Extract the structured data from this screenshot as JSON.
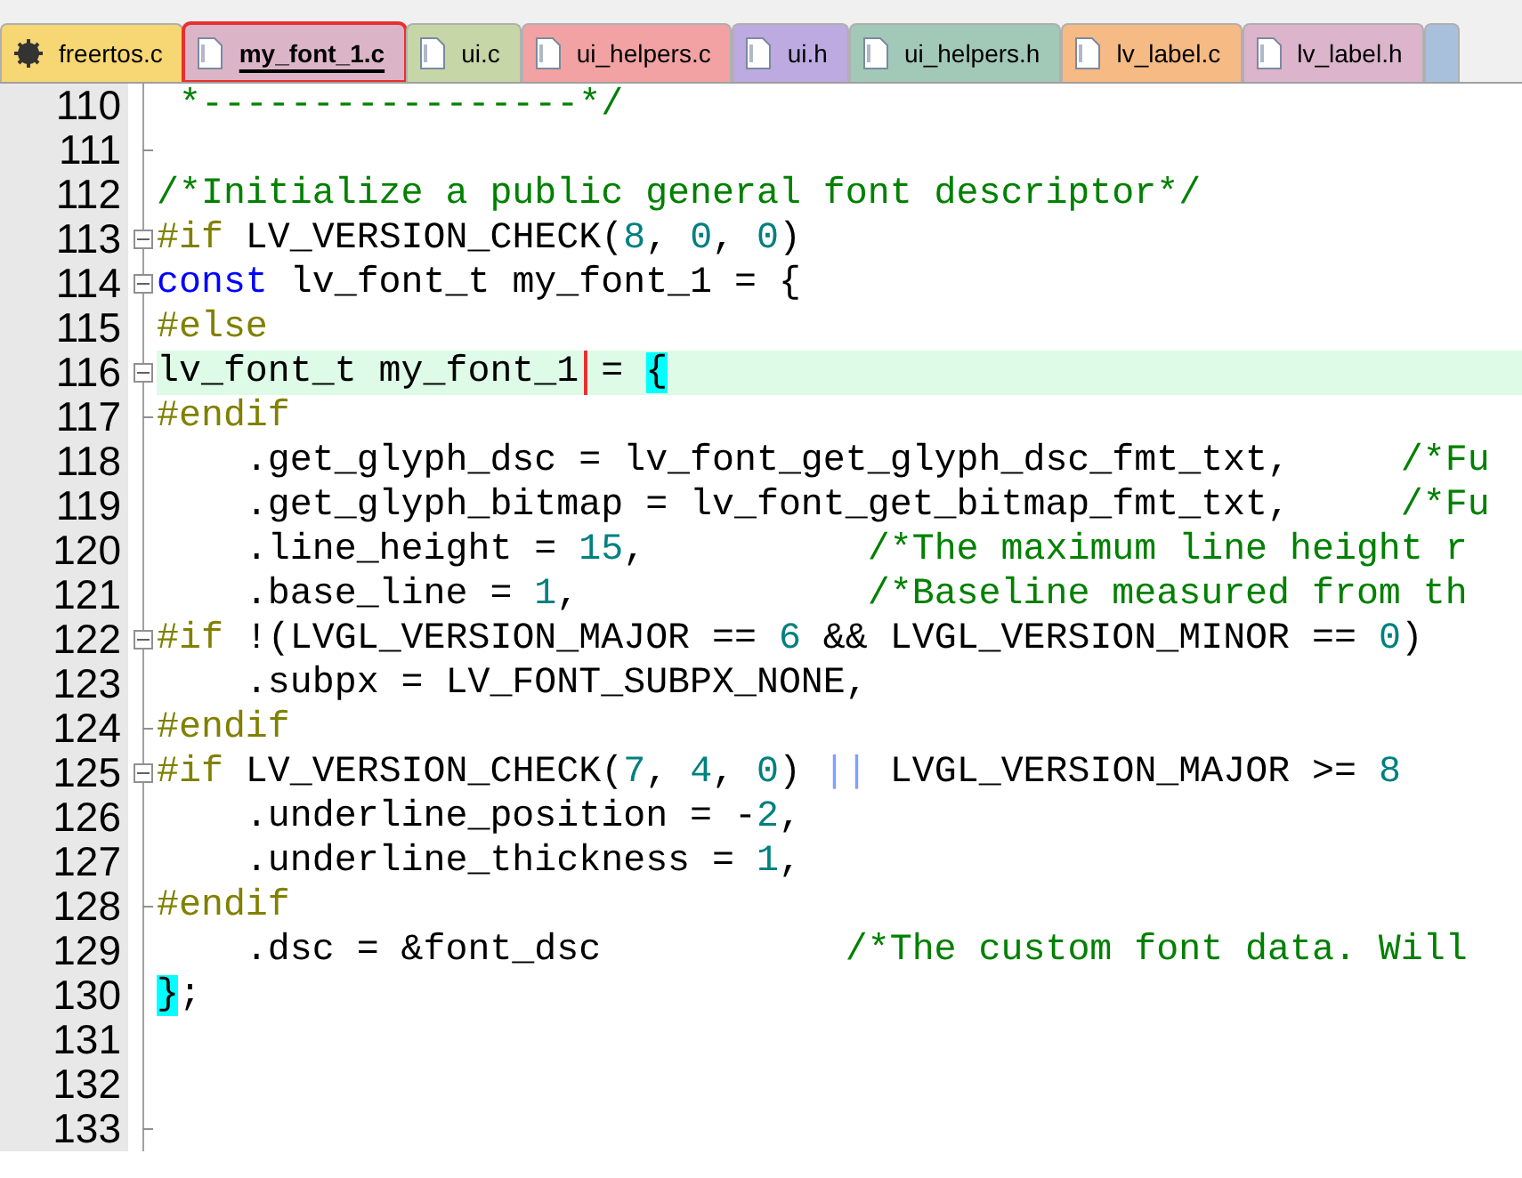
{
  "tabs": [
    {
      "label": "freertos.c",
      "kind": "gear",
      "color": "#f7d774",
      "selected": false,
      "highlighted": false
    },
    {
      "label": "my_font_1.c",
      "kind": "file",
      "color": "#dcb4c8",
      "selected": true,
      "highlighted": true
    },
    {
      "label": "ui.c",
      "kind": "file",
      "color": "#c6d6a6",
      "selected": false,
      "highlighted": false
    },
    {
      "label": "ui_helpers.c",
      "kind": "file",
      "color": "#f2a2a2",
      "selected": false,
      "highlighted": false
    },
    {
      "label": "ui.h",
      "kind": "file",
      "color": "#bcaae0",
      "selected": false,
      "highlighted": false
    },
    {
      "label": "ui_helpers.h",
      "kind": "file",
      "color": "#a2c8b8",
      "selected": false,
      "highlighted": false
    },
    {
      "label": "lv_label.c",
      "kind": "file",
      "color": "#f6ba84",
      "selected": false,
      "highlighted": false
    },
    {
      "label": "lv_label.h",
      "kind": "file",
      "color": "#dcb4cc",
      "selected": false,
      "highlighted": false
    }
  ],
  "editor": {
    "lines": [
      {
        "number": "110",
        "fold_start": false,
        "fold_end": false,
        "current": false,
        "segments": [
          {
            "kind": "comment",
            "text": " *-----------------*/"
          }
        ]
      },
      {
        "number": "111",
        "fold_start": false,
        "fold_end": true,
        "current": false
      },
      {
        "number": "112",
        "fold_start": false,
        "fold_end": false,
        "current": false,
        "segments": [
          {
            "kind": "comment",
            "text": "/*Initialize a public general font descriptor*/"
          }
        ]
      },
      {
        "number": "113",
        "fold_start": true,
        "fold_end": false,
        "current": false,
        "segments": [
          {
            "kind": "preproc",
            "text": "#if"
          },
          {
            "kind": "plain",
            "text": " LV_VERSION_CHECK("
          },
          {
            "kind": "number",
            "text": "8"
          },
          {
            "kind": "plain",
            "text": ", "
          },
          {
            "kind": "number",
            "text": "0"
          },
          {
            "kind": "plain",
            "text": ", "
          },
          {
            "kind": "number",
            "text": "0"
          },
          {
            "kind": "plain",
            "text": ")"
          }
        ]
      },
      {
        "number": "114",
        "fold_start": true,
        "fold_end": false,
        "current": false,
        "segments": [
          {
            "kind": "keyword",
            "text": "const"
          },
          {
            "kind": "plain",
            "text": " lv_font_t my_font_1 = {"
          }
        ]
      },
      {
        "number": "115",
        "fold_start": false,
        "fold_end": false,
        "current": false,
        "segments": [
          {
            "kind": "preproc",
            "text": "#else"
          }
        ]
      },
      {
        "number": "116",
        "fold_start": true,
        "fold_end": false,
        "current": true,
        "segments": [
          {
            "kind": "plain",
            "text": "lv_font_t my_font_1",
            "boxed": true
          },
          {
            "kind": "plain",
            "text": " = "
          },
          {
            "kind": "brace",
            "text": "{"
          }
        ]
      },
      {
        "number": "117",
        "fold_start": false,
        "fold_end": true,
        "current": false,
        "segments": [
          {
            "kind": "preproc",
            "text": "#endif"
          }
        ]
      },
      {
        "number": "118",
        "fold_start": false,
        "fold_end": false,
        "current": false,
        "segments": [
          {
            "kind": "plain",
            "text": "    .get_glyph_dsc = lv_font_get_glyph_dsc_fmt_txt,     "
          },
          {
            "kind": "comment",
            "text": "/*Fu"
          }
        ]
      },
      {
        "number": "119",
        "fold_start": false,
        "fold_end": false,
        "current": false,
        "segments": [
          {
            "kind": "plain",
            "text": "    .get_glyph_bitmap = lv_font_get_bitmap_fmt_txt,     "
          },
          {
            "kind": "comment",
            "text": "/*Fu"
          }
        ]
      },
      {
        "number": "120",
        "fold_start": false,
        "fold_end": false,
        "current": false,
        "segments": [
          {
            "kind": "plain",
            "text": "    .line_height = "
          },
          {
            "kind": "number",
            "text": "15"
          },
          {
            "kind": "plain",
            "text": ",          "
          },
          {
            "kind": "comment",
            "text": "/*The maximum line height r"
          }
        ]
      },
      {
        "number": "121",
        "fold_start": false,
        "fold_end": false,
        "current": false,
        "segments": [
          {
            "kind": "plain",
            "text": "    .base_line = "
          },
          {
            "kind": "number",
            "text": "1"
          },
          {
            "kind": "plain",
            "text": ",             "
          },
          {
            "kind": "comment",
            "text": "/*Baseline measured from th"
          }
        ]
      },
      {
        "number": "122",
        "fold_start": true,
        "fold_end": false,
        "current": false,
        "segments": [
          {
            "kind": "preproc",
            "text": "#if"
          },
          {
            "kind": "plain",
            "text": " !(LVGL_VERSION_MAJOR == "
          },
          {
            "kind": "number",
            "text": "6"
          },
          {
            "kind": "plain",
            "text": " && LVGL_VERSION_MINOR == "
          },
          {
            "kind": "number",
            "text": "0"
          },
          {
            "kind": "plain",
            "text": ")"
          }
        ]
      },
      {
        "number": "123",
        "fold_start": false,
        "fold_end": false,
        "current": false,
        "segments": [
          {
            "kind": "plain",
            "text": "    .subpx = LV_FONT_SUBPX_NONE,"
          }
        ]
      },
      {
        "number": "124",
        "fold_start": false,
        "fold_end": true,
        "current": false,
        "segments": [
          {
            "kind": "preproc",
            "text": "#endif"
          }
        ]
      },
      {
        "number": "125",
        "fold_start": true,
        "fold_end": false,
        "current": false,
        "segments": [
          {
            "kind": "preproc",
            "text": "#if"
          },
          {
            "kind": "plain",
            "text": " LV_VERSION_CHECK("
          },
          {
            "kind": "number",
            "text": "7"
          },
          {
            "kind": "plain",
            "text": ", "
          },
          {
            "kind": "number",
            "text": "4"
          },
          {
            "kind": "plain",
            "text": ", "
          },
          {
            "kind": "number",
            "text": "0"
          },
          {
            "kind": "plain",
            "text": ") "
          },
          {
            "kind": "operator",
            "text": "||"
          },
          {
            "kind": "plain",
            "text": " LVGL_VERSION_MAJOR >= "
          },
          {
            "kind": "number",
            "text": "8"
          }
        ]
      },
      {
        "number": "126",
        "fold_start": false,
        "fold_end": false,
        "current": false,
        "segments": [
          {
            "kind": "plain",
            "text": "    .underline_position = -"
          },
          {
            "kind": "number",
            "text": "2"
          },
          {
            "kind": "plain",
            "text": ","
          }
        ]
      },
      {
        "number": "127",
        "fold_start": false,
        "fold_end": false,
        "current": false,
        "segments": [
          {
            "kind": "plain",
            "text": "    .underline_thickness = "
          },
          {
            "kind": "number",
            "text": "1"
          },
          {
            "kind": "plain",
            "text": ","
          }
        ]
      },
      {
        "number": "128",
        "fold_start": false,
        "fold_end": true,
        "current": false,
        "segments": [
          {
            "kind": "preproc",
            "text": "#endif"
          }
        ]
      },
      {
        "number": "129",
        "fold_start": false,
        "fold_end": false,
        "current": false,
        "segments": [
          {
            "kind": "plain",
            "text": "    .dsc = &font_dsc           "
          },
          {
            "kind": "comment",
            "text": "/*The custom font data. Will"
          }
        ]
      },
      {
        "number": "130",
        "fold_start": false,
        "fold_end": false,
        "current": false,
        "segments": [
          {
            "kind": "brace",
            "text": "}"
          },
          {
            "kind": "plain",
            "text": ";"
          }
        ]
      },
      {
        "number": "131",
        "fold_start": false,
        "fold_end": false,
        "current": false
      },
      {
        "number": "132",
        "fold_start": false,
        "fold_end": false,
        "current": false
      },
      {
        "number": "133",
        "fold_start": false,
        "fold_end": true,
        "current": false
      }
    ]
  }
}
